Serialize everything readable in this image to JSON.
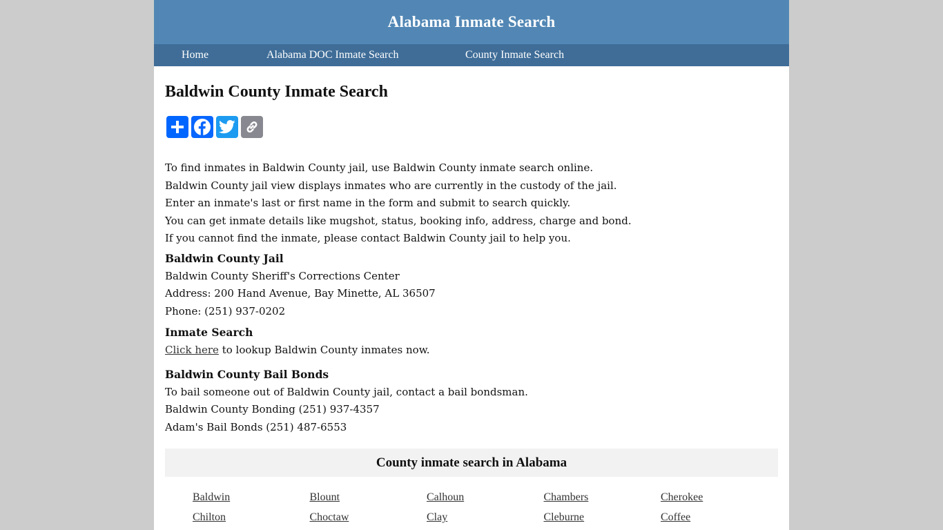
{
  "header": {
    "title": "Alabama Inmate Search"
  },
  "nav": {
    "items": [
      {
        "label": "Home"
      },
      {
        "label": "Alabama DOC Inmate Search"
      },
      {
        "label": "County Inmate Search"
      }
    ]
  },
  "main": {
    "title": "Baldwin County Inmate Search",
    "share_buttons": [
      {
        "name": "share",
        "icon": "plus-icon",
        "color": "#0166ff"
      },
      {
        "name": "facebook",
        "icon": "facebook-icon",
        "color": "#0866ff"
      },
      {
        "name": "twitter",
        "icon": "twitter-icon",
        "color": "#1d9bf0"
      },
      {
        "name": "copy-link",
        "icon": "link-icon",
        "color": "#888990"
      }
    ],
    "intro": [
      "To find inmates in Baldwin County jail, use Baldwin County inmate search online.",
      "Baldwin County jail view displays inmates who are currently in the custody of the jail.",
      "Enter an inmate's last or first name in the form and submit to search quickly.",
      "You can get inmate details like mugshot, status, booking info, address, charge and bond.",
      "If you cannot find the inmate, please contact Baldwin County jail to help you."
    ],
    "jail": {
      "heading": "Baldwin County Jail",
      "name": "Baldwin County Sheriff's Corrections Center",
      "address": "Address: 200 Hand Avenue, Bay Minette, AL 36507",
      "phone": "Phone: (251) 937-0202"
    },
    "inmate_search": {
      "heading": "Inmate Search",
      "link_label": "Click here",
      "text": " to lookup Baldwin County inmates now."
    },
    "bail_bonds": {
      "heading": "Baldwin County Bail Bonds",
      "lines": [
        "To bail someone out of Baldwin County jail, contact a bail bondsman.",
        "Baldwin County Bonding (251) 937-4357",
        "Adam's Bail Bonds (251) 487-6553"
      ]
    }
  },
  "counties": {
    "heading": "County inmate search in Alabama",
    "items": [
      "Baldwin",
      "Blount",
      "Calhoun",
      "Chambers",
      "Cherokee",
      "Chilton",
      "Choctaw",
      "Clay",
      "Cleburne",
      "Coffee"
    ]
  },
  "colors": {
    "header_bg": "#5287b5",
    "nav_bg": "#3f6d98",
    "page_bg": "#cccccc"
  }
}
